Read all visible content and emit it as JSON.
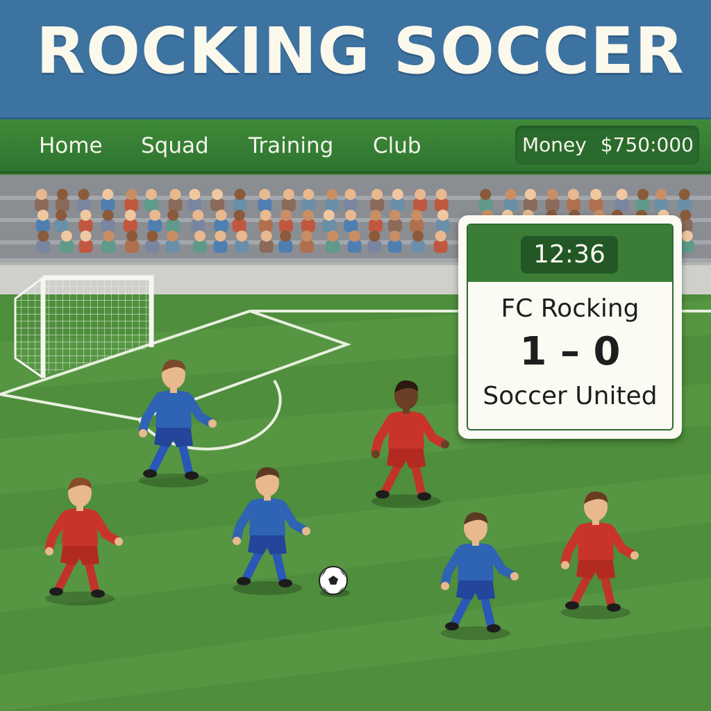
{
  "game": {
    "title": "ROCKING SOCCER"
  },
  "nav": {
    "items": [
      {
        "label": "Home"
      },
      {
        "label": "Squad"
      },
      {
        "label": "Training"
      },
      {
        "label": "Club"
      }
    ],
    "money": {
      "label": "Money",
      "value": "$750:000"
    }
  },
  "scoreboard": {
    "clock": "12:36",
    "home_team": "FC Rocking",
    "score": "1 – 0",
    "away_team": "Soccer United"
  },
  "match": {
    "home_kit_color": "#c8342b",
    "away_kit_color": "#2f63b3",
    "shorts_blue": "#23469a",
    "pitch_color": "#4e8e3c"
  },
  "colors": {
    "header_blue": "#3d73a1",
    "nav_green": "#3a8236",
    "scoreboard_green": "#3b7d36"
  }
}
